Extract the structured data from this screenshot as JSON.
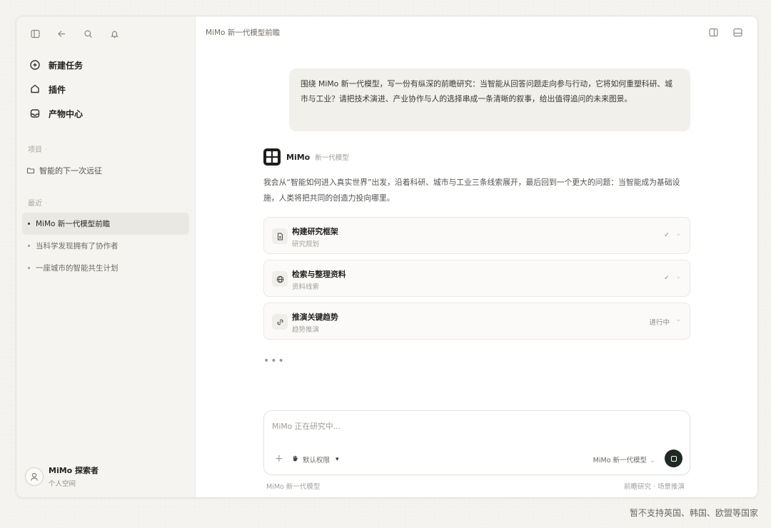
{
  "sidebar": {
    "nav": [
      {
        "label": "新建任务",
        "icon": "new-task-icon"
      },
      {
        "label": "插件",
        "icon": "plugin-icon"
      },
      {
        "label": "产物中心",
        "icon": "inbox-icon"
      }
    ],
    "projects_label": "项目",
    "project_item": "智能的下一次远征",
    "recent_label": "最近",
    "recent": [
      {
        "label": "MiMo 新一代模型前瞻",
        "active": true
      },
      {
        "label": "当科学发现拥有了协作者",
        "active": false
      },
      {
        "label": "一座城市的智能共生计划",
        "active": false
      }
    ],
    "user": {
      "name": "MiMo 探索者",
      "sub": "个人空间"
    }
  },
  "header": {
    "title": "MiMo 新一代模型前瞻"
  },
  "conversation": {
    "user_message": "围绕 MiMo 新一代模型，写一份有纵深的前瞻研究：当智能从回答问题走向参与行动，它将如何重塑科研、城市与工业？请把技术演进、产业协作与人的选择串成一条清晰的叙事，给出值得追问的未来图景。",
    "assistant": {
      "name": "MiMo",
      "tag": "新一代模型",
      "text": "我会从“智能如何进入真实世界”出发，沿着科研、城市与工业三条线索展开，最后回到一个更大的问题：当智能成为基础设施，人类将把共同的创造力投向哪里。"
    },
    "steps": [
      {
        "title": "构建研究框架",
        "sub": "研究规划",
        "status": "✓",
        "icon": "document-icon"
      },
      {
        "title": "检索与整理资料",
        "sub": "资料线索",
        "status": "✓",
        "icon": "globe-icon"
      },
      {
        "title": "推演关键趋势",
        "sub": "趋势推演",
        "status": "进行中",
        "icon": "link-icon"
      }
    ],
    "typing": "•••"
  },
  "composer": {
    "placeholder": "MiMo 正在研究中...",
    "plus": "+",
    "permission": "默认权限",
    "model": "MiMo 新一代模型",
    "footer_left": "MiMo 新一代模型",
    "footer_right": "前瞻研究 · 场景推演"
  },
  "region_note": "暂不支持英国、韩国、欧盟等国家"
}
